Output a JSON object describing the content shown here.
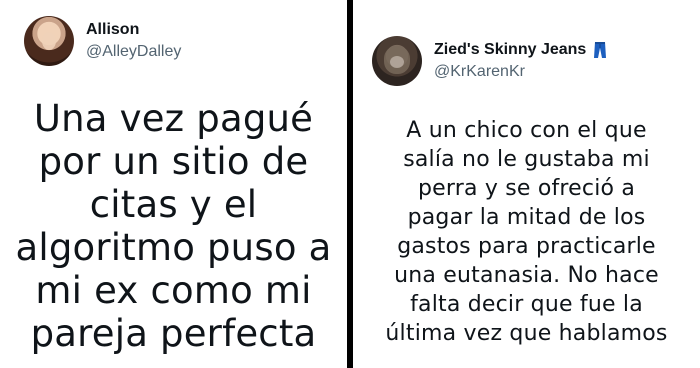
{
  "left_tweet": {
    "name": "Allison",
    "handle": "@AlleyDalley",
    "lines": [
      "Una vez pagué",
      "por un sitio de",
      "citas y el",
      "algoritmo puso a",
      "mi ex como mi",
      "pareja perfecta"
    ]
  },
  "right_tweet": {
    "name": "Zied's Skinny Jeans",
    "handle": "@KrKarenKr",
    "name_icon": "jeans-icon",
    "lines": [
      "A un chico con el que",
      "salía no le gustaba mi",
      "perra y se ofreció a",
      "pagar la mitad de los",
      "gastos para practicarle",
      "una eutanasia. No hace",
      "falta decir que fue la",
      "última vez que hablamos"
    ]
  },
  "colors": {
    "text": "#0f1419",
    "handle": "#536471",
    "divider": "#000000",
    "icon_blue": "#1d5fbf"
  }
}
